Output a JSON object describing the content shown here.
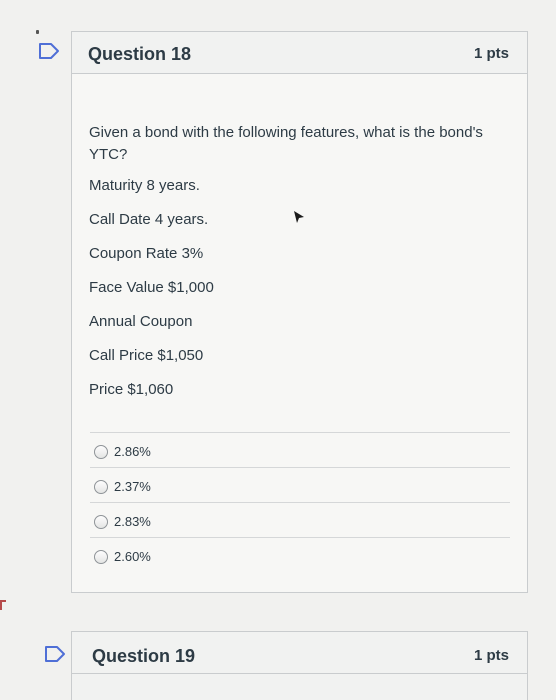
{
  "question18": {
    "title": "Question 18",
    "points": "1 pts",
    "prompt": "Given a bond with the following features, what is the bond's YTC?",
    "features": [
      "Maturity 8 years.",
      "Call Date 4 years.",
      "Coupon Rate 3%",
      "Face Value $1,000",
      "Annual Coupon",
      "Call Price $1,050",
      "Price $1,060"
    ],
    "answers": [
      "2.86%",
      "2.37%",
      "2.83%",
      "2.60%"
    ]
  },
  "question19": {
    "title": "Question 19",
    "points": "1 pts"
  },
  "colors": {
    "text": "#2d3b45",
    "flag": "#4f6fd6",
    "border": "#c9ccce"
  }
}
